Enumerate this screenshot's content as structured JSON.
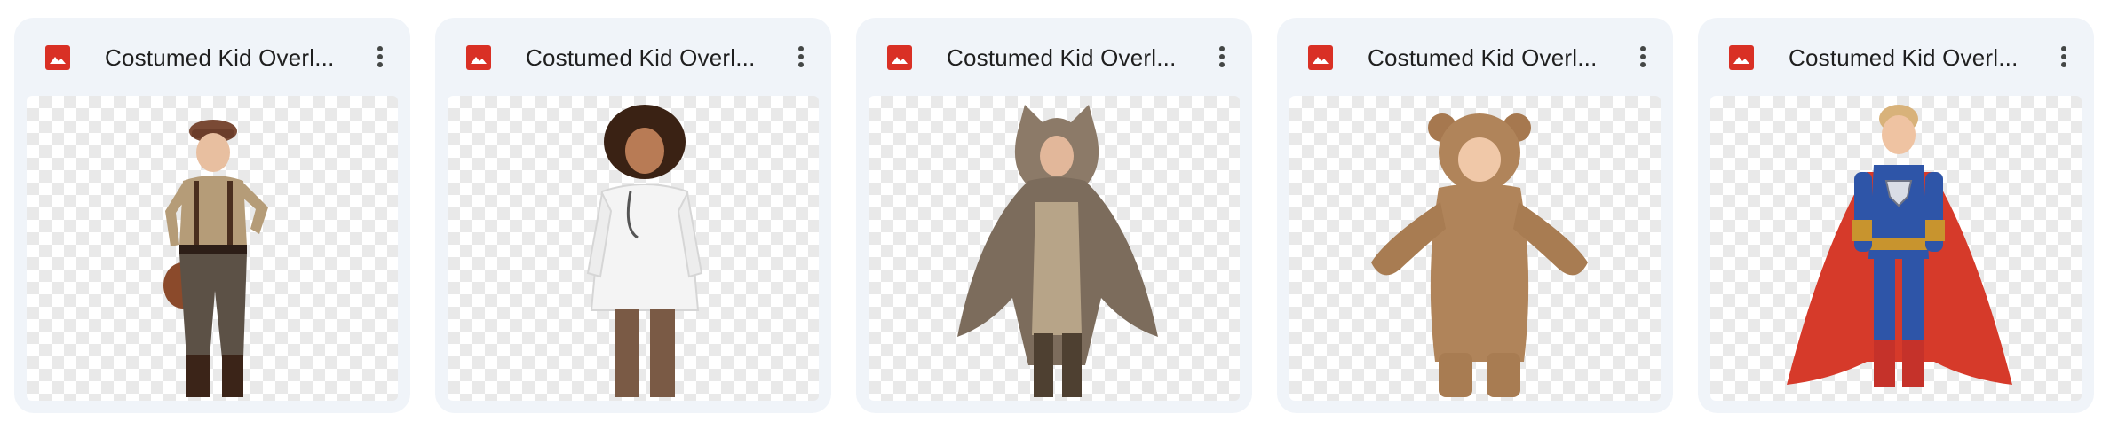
{
  "files": [
    {
      "title": "Costumed Kid Overl...",
      "file_type_icon": "image-icon",
      "menu_icon": "more-vert-icon",
      "subject": "baseball-kid"
    },
    {
      "title": "Costumed Kid Overl...",
      "file_type_icon": "image-icon",
      "menu_icon": "more-vert-icon",
      "subject": "doctor-kid"
    },
    {
      "title": "Costumed Kid Overl...",
      "file_type_icon": "image-icon",
      "menu_icon": "more-vert-icon",
      "subject": "wolf-kid"
    },
    {
      "title": "Costumed Kid Overl...",
      "file_type_icon": "image-icon",
      "menu_icon": "more-vert-icon",
      "subject": "bear-kid"
    },
    {
      "title": "Costumed Kid Overl...",
      "file_type_icon": "image-icon",
      "menu_icon": "more-vert-icon",
      "subject": "superhero-kid"
    }
  ],
  "colors": {
    "card_bg": "#f0f4f9",
    "image_icon": "#d93025",
    "title_text": "#1f1f1f",
    "menu_dots": "#444746"
  }
}
